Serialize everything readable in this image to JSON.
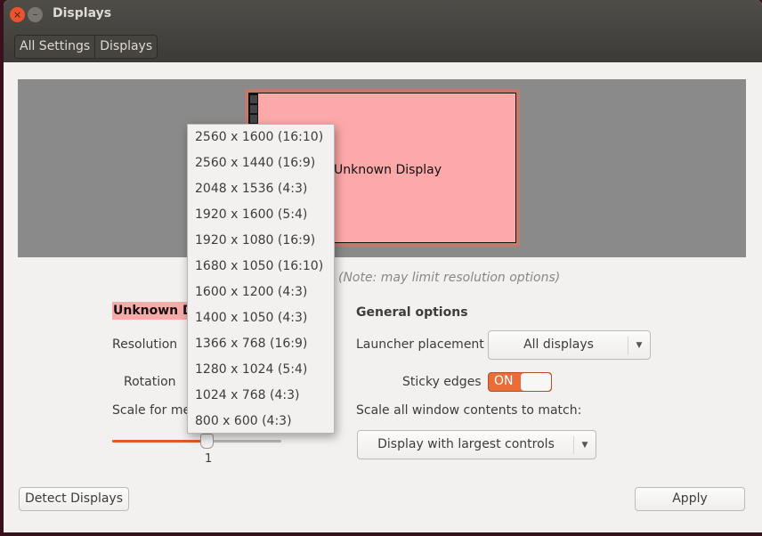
{
  "window": {
    "title": "Displays"
  },
  "breadcrumb": [
    "All Settings",
    "Displays"
  ],
  "preview": {
    "monitor_label": "Unknown Display"
  },
  "note": "(Note: may limit resolution options)",
  "display": {
    "name": "Unknown Display",
    "resolution_label": "Resolution",
    "rotation_label": "Rotation",
    "scale_label": "Scale for menu and title bars:",
    "scale_value": "1",
    "scale_fraction": 0.56
  },
  "resolution_menu": [
    "2560 x 1600 (16:10)",
    "2560 x 1440 (16:9)",
    "2048 x 1536 (4:3)",
    "1920 x 1600 (5:4)",
    "1920 x 1080 (16:9)",
    "1680 x 1050 (16:10)",
    "1600 x 1200 (4:3)",
    "1400 x 1050 (4:3)",
    "1366 x 768 (16:9)",
    "1280 x 1024 (5:4)",
    "1024 x 768 (4:3)",
    "800 x 600 (4:3)"
  ],
  "general": {
    "heading": "General options",
    "launcher_label": "Launcher placement",
    "launcher_value": "All displays",
    "sticky_label": "Sticky edges",
    "sticky_value": "ON",
    "scale_all_label": "Scale all window contents to match:",
    "scale_all_value": "Display with largest controls"
  },
  "buttons": {
    "detect": "Detect Displays",
    "apply": "Apply"
  },
  "colors": {
    "accent": "#e96d39",
    "monitor": "#fda9a9"
  }
}
